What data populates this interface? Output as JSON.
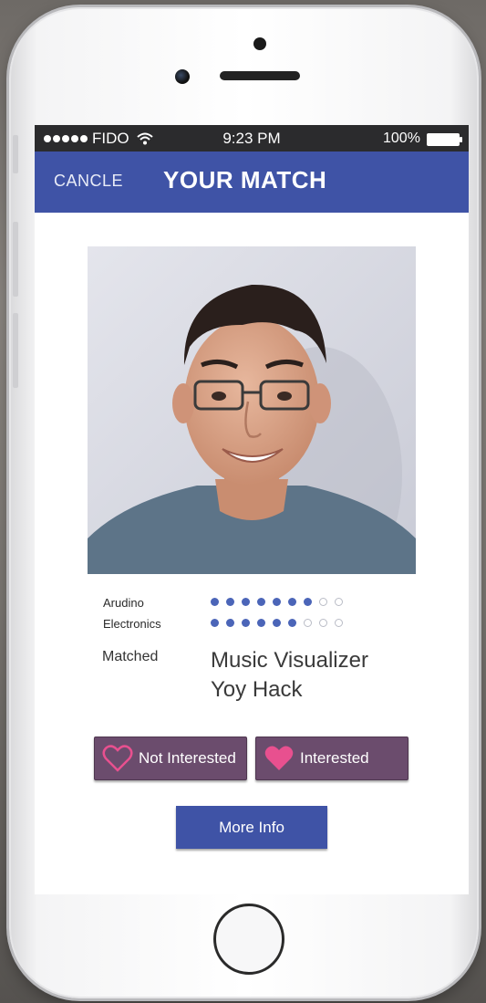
{
  "status_bar": {
    "carrier": "FIDO",
    "time": "9:23 PM",
    "battery": "100%",
    "signal_bars": 5,
    "icons": [
      "wifi-icon",
      "battery-icon"
    ]
  },
  "nav": {
    "cancel_label": "CANCLE",
    "title": "YOUR MATCH",
    "color": "#3f53a6"
  },
  "skills": [
    {
      "label": "Arudino",
      "filled": 7,
      "total": 9
    },
    {
      "label": "Electronics",
      "filled": 6,
      "total": 9
    }
  ],
  "matched": {
    "label": "Matched",
    "project_line1": "Music Visualizer",
    "project_line2": "Yoy Hack"
  },
  "actions": {
    "not_interested_label": "Not Interested",
    "interested_label": "Interested",
    "more_info_label": "More Info",
    "heart_color": "#e8508f",
    "button_color": "#6b4c6d"
  }
}
